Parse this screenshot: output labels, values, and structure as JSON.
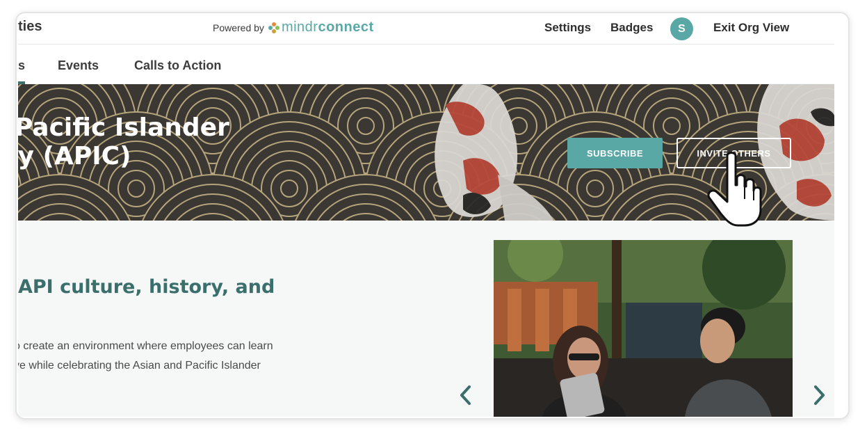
{
  "header": {
    "brand_title": "ties",
    "powered_by": "Powered by",
    "logo_part1": "mindr",
    "logo_part2": "connect",
    "nav": {
      "settings": "Settings",
      "badges": "Badges",
      "exit": "Exit Org View"
    },
    "avatar_initial": "S"
  },
  "tabs": [
    {
      "label": "s"
    },
    {
      "label": "Events"
    },
    {
      "label": "Calls to Action"
    }
  ],
  "banner": {
    "title_line1": "l Pacific Islander",
    "title_line2": "ity (APIC)",
    "subscribe_label": "SUBSCRIBE",
    "invite_label": "INVITE OTHERS"
  },
  "content": {
    "headline": "API culture, history, and",
    "description_line1": "o create an environment where employees can learn",
    "description_line2": "ve while celebrating the Asian and Pacific Islander"
  },
  "icons": {
    "prev": "chevron-left-icon",
    "next": "chevron-right-icon",
    "cursor": "hand-pointer-icon"
  },
  "colors": {
    "accent": "#5aa8a6",
    "heading": "#3b6f6b",
    "banner_bg": "#3b3833",
    "banner_lines": "#b6a57c"
  }
}
